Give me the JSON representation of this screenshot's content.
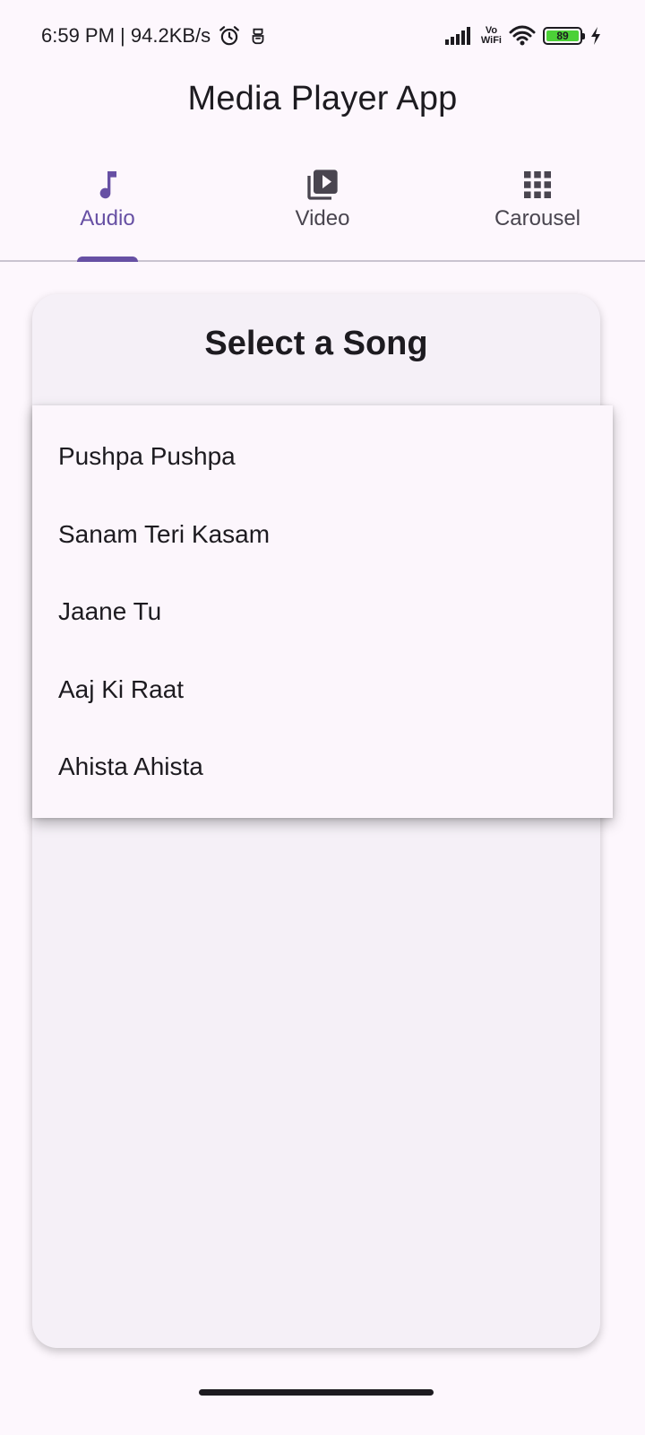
{
  "status_bar": {
    "time_speed": "6:59 PM | 94.2KB/s",
    "vowifi_top": "Vo",
    "vowifi_bottom": "WiFi",
    "battery": "89"
  },
  "app_bar": {
    "title": "Media Player App"
  },
  "tabs": [
    {
      "label": "Audio",
      "icon": "music-note-icon",
      "active": true
    },
    {
      "label": "Video",
      "icon": "video-library-icon",
      "active": false
    },
    {
      "label": "Carousel",
      "icon": "grid-icon",
      "active": false
    }
  ],
  "card": {
    "title": "Select a Song"
  },
  "menu": {
    "items": [
      {
        "label": "Pushpa Pushpa"
      },
      {
        "label": "Sanam Teri Kasam"
      },
      {
        "label": "Jaane Tu"
      },
      {
        "label": "Aaj Ki Raat"
      },
      {
        "label": "Ahista Ahista"
      }
    ]
  },
  "colors": {
    "accent": "#6750a4",
    "background": "#fdf7fd",
    "card": "#f5f0f7",
    "menu": "#fcf6fc"
  }
}
